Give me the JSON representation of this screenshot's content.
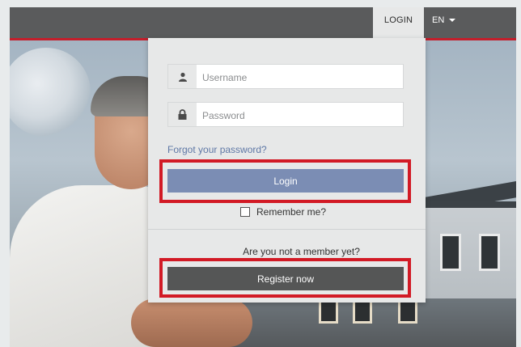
{
  "topbar": {
    "login_tab": "LOGIN",
    "language": "EN"
  },
  "login_form": {
    "username_placeholder": "Username",
    "password_placeholder": "Password",
    "forgot_link": "Forgot your password?",
    "login_button": "Login",
    "remember_label": "Remember me?",
    "remember_checked": false,
    "not_member_text": "Are you not a member yet?",
    "register_button": "Register now"
  },
  "icons": {
    "username": "user-icon",
    "password": "lock-icon",
    "language_dropdown": "caret-down-icon"
  },
  "colors": {
    "accent_red": "#c41e2b",
    "highlight_red": "#d21a25",
    "login_button": "#7b8db4",
    "register_button": "#555656",
    "topbar": "#5a5b5c",
    "panel": "#e7e8e8",
    "link": "#5f78a6"
  }
}
